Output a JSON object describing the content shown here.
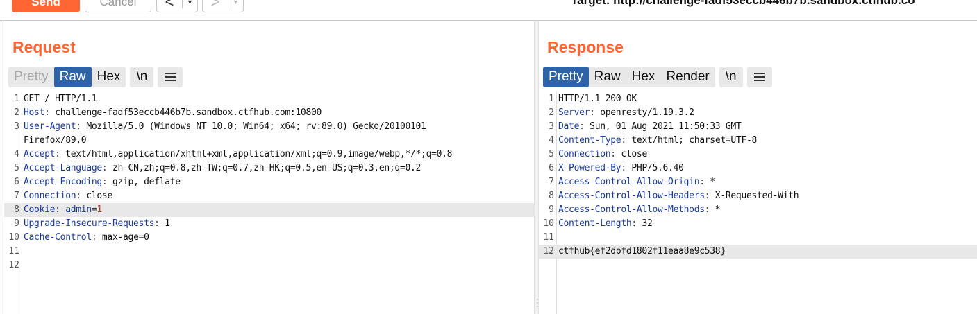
{
  "toolbar": {
    "send_label": "Send",
    "cancel_label": "Cancel",
    "back_glyph": "<",
    "forward_glyph": ">",
    "dropdown_glyph": "▼",
    "target_label": "Target: http://challenge-fadf53eccb446b7b.sandbox.ctfhub.co"
  },
  "request": {
    "title": "Request",
    "tabs": {
      "pretty": "Pretty",
      "raw": "Raw",
      "hex": "Hex",
      "newline": "\\n"
    },
    "line_numbers": [
      "1",
      "2",
      "3",
      "",
      "4",
      "5",
      "6",
      "7",
      "8",
      "9",
      "10",
      "11",
      "12"
    ],
    "lines": [
      {
        "text": "GET / HTTP/1.1"
      },
      {
        "key": "Host",
        "value": " challenge-fadf53eccb446b7b.sandbox.ctfhub.com:10800"
      },
      {
        "key": "User-Agent",
        "value": " Mozilla/5.0 (Windows NT 10.0; Win64; x64; rv:89.0) Gecko/20100101"
      },
      {
        "text": "Firefox/89.0"
      },
      {
        "key": "Accept",
        "value": " text/html,application/xhtml+xml,application/xml;q=0.9,image/webp,*/*;q=0.8"
      },
      {
        "key": "Accept-Language",
        "value": " zh-CN,zh;q=0.8,zh-TW;q=0.7,zh-HK;q=0.5,en-US;q=0.3,en;q=0.2"
      },
      {
        "key": "Accept-Encoding",
        "value": " gzip, deflate"
      },
      {
        "key": "Connection",
        "value": " close"
      },
      {
        "key": "Cookie",
        "cookie_name": " admin",
        "cookie_eq": "=",
        "cookie_value": "1"
      },
      {
        "key": "Upgrade-Insecure-Requests",
        "value": " 1"
      },
      {
        "key": "Cache-Control",
        "value": " max-age=0"
      },
      {
        "text": ""
      },
      {
        "text": ""
      }
    ]
  },
  "response": {
    "title": "Response",
    "tabs": {
      "pretty": "Pretty",
      "raw": "Raw",
      "hex": "Hex",
      "render": "Render",
      "newline": "\\n"
    },
    "line_numbers": [
      "1",
      "2",
      "3",
      "4",
      "5",
      "6",
      "7",
      "8",
      "9",
      "10",
      "11",
      "12"
    ],
    "lines": [
      {
        "text": "HTTP/1.1 200 OK"
      },
      {
        "key": "Server",
        "value": " openresty/1.19.3.2"
      },
      {
        "key": "Date",
        "value": " Sun, 01 Aug 2021 11:50:33 GMT"
      },
      {
        "key": "Content-Type",
        "value": " text/html; charset=UTF-8"
      },
      {
        "key": "Connection",
        "value": " close"
      },
      {
        "key": "X-Powered-By",
        "value": " PHP/5.6.40"
      },
      {
        "key": "Access-Control-Allow-Origin",
        "value": " *"
      },
      {
        "key": "Access-Control-Allow-Headers",
        "value": " X-Requested-With"
      },
      {
        "key": "Access-Control-Allow-Methods",
        "value": " *"
      },
      {
        "key": "Content-Length",
        "value": " 32"
      },
      {
        "text": ""
      },
      {
        "text": "ctfhub{ef2dbfd1802f11eaa8e9c538}"
      }
    ]
  },
  "colors": {
    "accent": "#ff6633",
    "tab_active": "#2e63a6",
    "header_key": "#1a3b9c",
    "cookie_value": "#c0392b"
  }
}
